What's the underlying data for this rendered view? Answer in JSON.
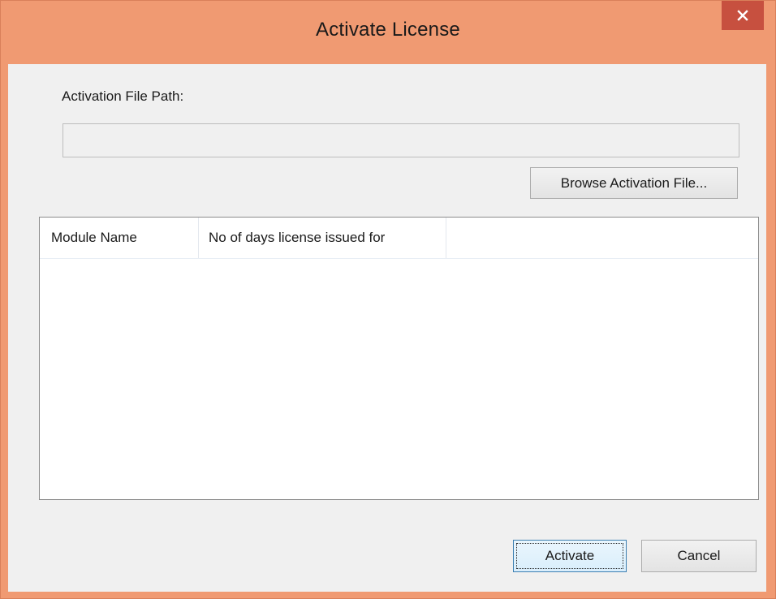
{
  "window": {
    "title": "Activate License",
    "frame_color": "#f09a72",
    "close_button_color": "#c7503f",
    "close_icon": "close-icon"
  },
  "form": {
    "path_label": "Activation File Path:",
    "path_value": "",
    "path_placeholder": "",
    "browse_label": "Browse Activation File..."
  },
  "table": {
    "columns": [
      "Module Name",
      "No of days license issued for"
    ],
    "rows": []
  },
  "footer": {
    "activate_label": "Activate",
    "cancel_label": "Cancel"
  }
}
